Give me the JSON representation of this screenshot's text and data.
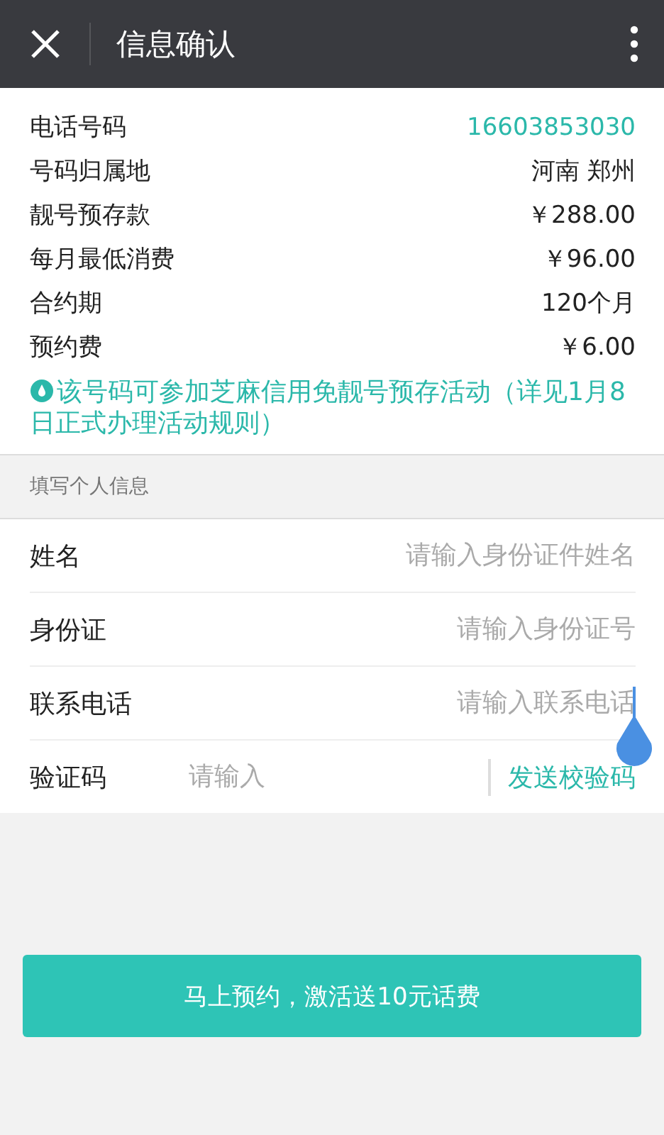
{
  "top_bar": {
    "title": "信息确认"
  },
  "details": [
    {
      "label": "电话号码",
      "value": "16603853030",
      "highlight": true
    },
    {
      "label": "号码归属地",
      "value": "河南 郑州",
      "highlight": false
    },
    {
      "label": "靓号预存款",
      "value": "￥288.00",
      "highlight": false
    },
    {
      "label": "每月最低消费",
      "value": "￥96.00",
      "highlight": false
    },
    {
      "label": "合约期",
      "value": "120个月",
      "highlight": false
    },
    {
      "label": "预约费",
      "value": "￥6.00",
      "highlight": false
    }
  ],
  "notice": "该号码可参加芝麻信用免靓号预存活动（详见1月8日正式办理活动规则）",
  "section_title": "填写个人信息",
  "fields": [
    {
      "kind": "input",
      "label": "姓名",
      "placeholder": "请输入身份证件姓名",
      "focused": false
    },
    {
      "kind": "input",
      "label": "身份证",
      "placeholder": "请输入身份证号",
      "focused": false
    },
    {
      "kind": "input",
      "label": "联系电话",
      "placeholder": "请输入联系电话",
      "focused": true
    },
    {
      "kind": "code",
      "label": "验证码",
      "placeholder": "请输入",
      "focused": false,
      "action": "发送校验码"
    }
  ],
  "submit_button": "马上预约，激活送10元话费"
}
